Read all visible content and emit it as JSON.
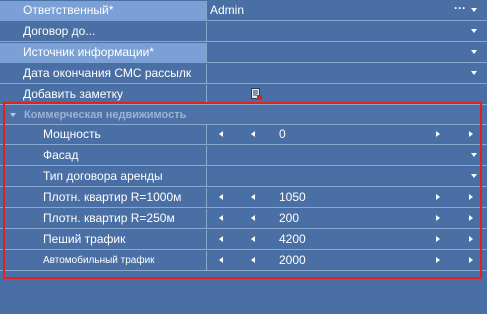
{
  "properties": [
    {
      "label": "Ответственный*",
      "value": "Admin",
      "selected": true,
      "ellipsis": "···"
    },
    {
      "label": "Договор до...",
      "value": ""
    },
    {
      "label": "Источник информации*",
      "value": "",
      "selected": true
    },
    {
      "label": "Дата окончания СМС рассылк",
      "value": ""
    },
    {
      "label": "Добавить заметку",
      "icon": "note-icon"
    }
  ],
  "group": {
    "title": "Коммерческая недвижимость",
    "rows": [
      {
        "label": "Мощность",
        "value": "0",
        "kind": "spin"
      },
      {
        "label": "Фасад",
        "value": "",
        "kind": "dropdown"
      },
      {
        "label": "Тип договора аренды",
        "value": "",
        "kind": "dropdown"
      },
      {
        "label": "Плотн. квартир R=1000м",
        "value": "1050",
        "kind": "spin"
      },
      {
        "label": "Плотн. квартир R=250м",
        "value": "200",
        "kind": "spin"
      },
      {
        "label": "Пеший трафик",
        "value": "4200",
        "kind": "spin"
      },
      {
        "label": "Автомобильный трафик",
        "value": "2000",
        "kind": "spin",
        "small": true
      }
    ]
  },
  "colors": {
    "background": "#4a6fa5",
    "selected": "#7aa0d6",
    "highlight_frame": "#e3201b",
    "group_title": "#9db2d2"
  }
}
